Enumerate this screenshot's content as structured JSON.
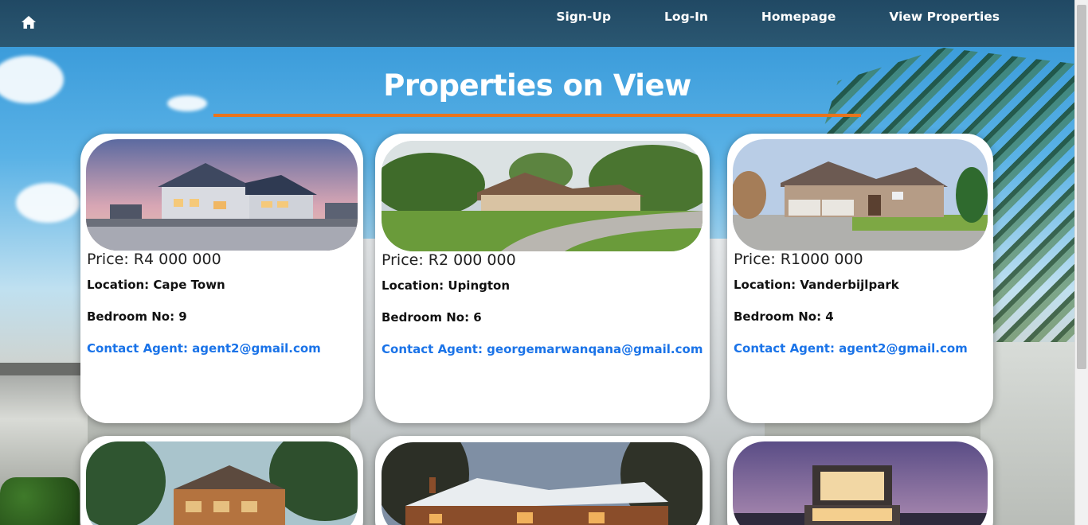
{
  "nav": {
    "home_icon": "home-icon",
    "links": [
      "Sign-Up",
      "Log-In",
      "Homepage",
      "View Properties"
    ]
  },
  "page": {
    "title": "Properties on View",
    "accent_color": "#e8741c",
    "link_color": "#1a73e8"
  },
  "properties": [
    {
      "price": "Price: R4 000 000",
      "location": "Location: Cape Town",
      "bedrooms": "Bedroom No: 9",
      "contact": "Contact Agent: agent2@gmail.com"
    },
    {
      "price": "Price: R2 000 000",
      "location": "Location: Upington",
      "bedrooms": "Bedroom No: 6",
      "contact": "Contact Agent: georgemarwanqana@gmail.com"
    },
    {
      "price": "Price: R1000 000",
      "location": "Location: Vanderbijlpark",
      "bedrooms": "Bedroom No: 4",
      "contact": "Contact Agent: agent2@gmail.com"
    },
    {
      "image": "forest-lodge-photo"
    },
    {
      "image": "log-cabin-snow-photo"
    },
    {
      "image": "modern-house-dusk-photo"
    }
  ]
}
